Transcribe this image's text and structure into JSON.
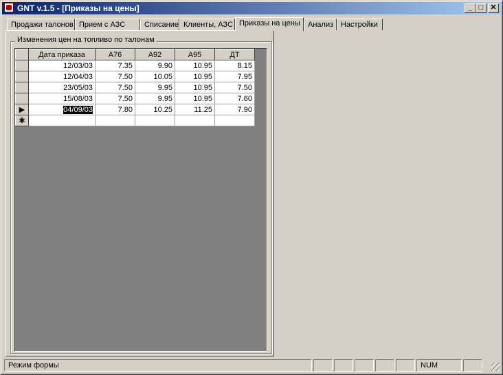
{
  "window": {
    "title": "GNT v.1.5 - [Приказы на цены]"
  },
  "title_buttons": {
    "minimize": "_",
    "maximize": "□",
    "close": "✕"
  },
  "tabs": [
    {
      "label": "Продажи талонов",
      "active": false
    },
    {
      "label": "Прием с  АЗС",
      "active": false
    },
    {
      "label": "Списание",
      "active": false
    },
    {
      "label": "Клиенты, АЗС",
      "active": false
    },
    {
      "label": "Приказы на цены",
      "active": true
    },
    {
      "label": "Анализ",
      "active": false
    },
    {
      "label": "Настройки",
      "active": false
    }
  ],
  "group": {
    "label": "Изменения цен на топливо по талонам"
  },
  "grid": {
    "columns": [
      "Дата приказа",
      "А76",
      "А92",
      "А95",
      "ДТ"
    ],
    "rows": [
      [
        "12/03/03",
        "7.35",
        "9.90",
        "10.95",
        "8.15"
      ],
      [
        "12/04/03",
        "7.50",
        "10.05",
        "10.95",
        "7.95"
      ],
      [
        "23/05/03",
        "7.50",
        "9.95",
        "10.95",
        "7.50"
      ],
      [
        "15/08/03",
        "7.50",
        "9.95",
        "10.95",
        "7.60"
      ],
      [
        "04/09/03",
        "7.80",
        "10.25",
        "11.25",
        "7.90"
      ]
    ],
    "current_row_marker": "▶",
    "new_row_marker": "✱"
  },
  "statusbar": {
    "mode": "Режим формы",
    "num": "NUM"
  }
}
